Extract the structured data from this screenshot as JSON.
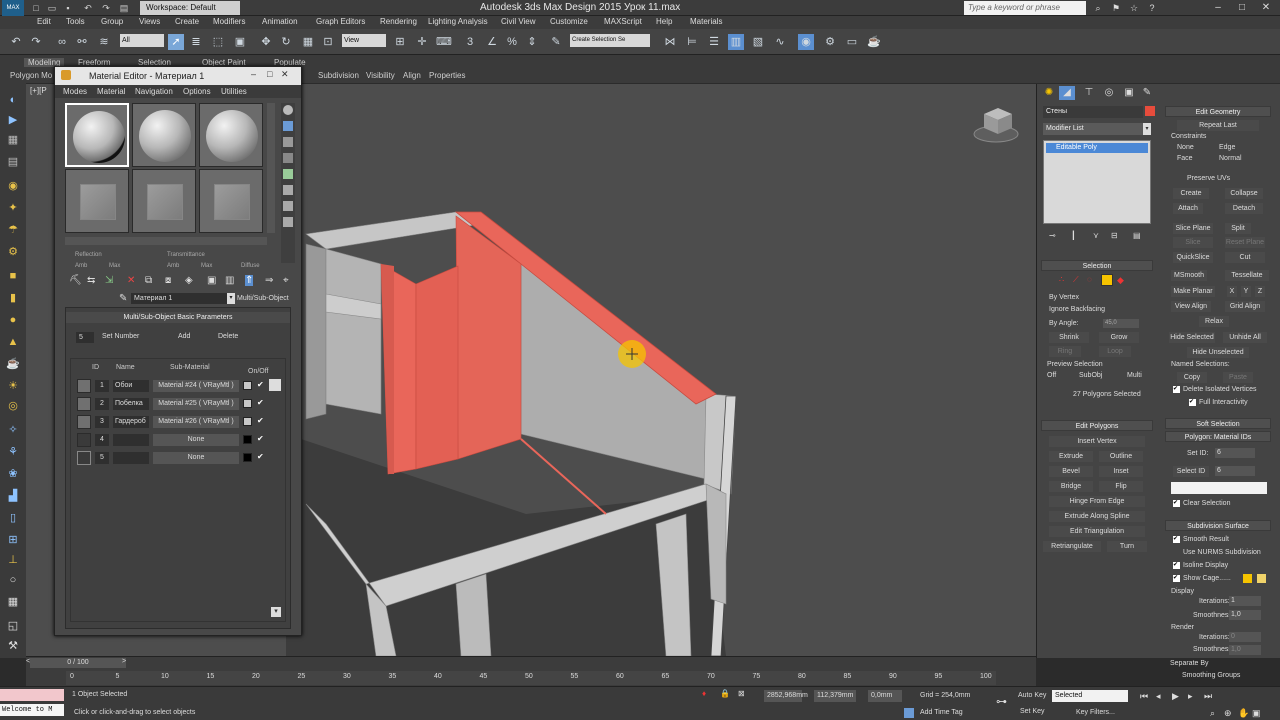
{
  "app": {
    "logo": "MAX",
    "workspace": "Workspace: Default",
    "window_title": "Autodesk 3ds Max Design 2015     Урок 11.max",
    "search_placeholder": "Type a keyword or phrase"
  },
  "menu": [
    "Edit",
    "Tools",
    "Group",
    "Views",
    "Create",
    "Modifiers",
    "Animation",
    "Graph Editors",
    "Rendering",
    "Lighting Analysis",
    "Civil View",
    "Customize",
    "MAXScript",
    "Help",
    "Materials"
  ],
  "toolbar": {
    "filter_value": "All",
    "ref_coord_value": "View",
    "named_sel_value": "Create Selection Se"
  },
  "ribbon": {
    "tabs": [
      "Modeling",
      "Freeform",
      "Selection",
      "Object Paint",
      "Populate"
    ],
    "sub": [
      "Polygon Mo",
      "Subdivision",
      "Visibility",
      "Align",
      "Properties"
    ]
  },
  "viewport": {
    "label": "[+][P"
  },
  "material_editor": {
    "title": "Material Editor - Материал 1",
    "menu": [
      "Modes",
      "Material",
      "Navigation",
      "Options",
      "Utilities"
    ],
    "rows_top": [
      "Reflection",
      "Transmittance",
      "Diffuse",
      "Amb",
      "Max",
      "Amb",
      "Max"
    ],
    "material_name": "Материал 1",
    "material_type": "Multi/Sub-Object",
    "rollout_title": "Multi/Sub-Object Basic Parameters",
    "set_number_value": "5",
    "set_number_label": "Set Number",
    "add_label": "Add",
    "delete_label": "Delete",
    "columns": [
      "ID",
      "Name",
      "Sub-Material",
      "On/Off"
    ],
    "rows": [
      {
        "id": "1",
        "name": "Обои",
        "sub": "Material #24  ( VRayMtl )",
        "color": "#c8c8c8"
      },
      {
        "id": "2",
        "name": "Побелка",
        "sub": "Material #25  ( VRayMtl )",
        "color": "#c8c8c8"
      },
      {
        "id": "3",
        "name": "Гардероб",
        "sub": "Material #26  ( VRayMtl )",
        "color": "#c8c8c8"
      },
      {
        "id": "4",
        "name": "",
        "sub": "None",
        "color": "#000000"
      },
      {
        "id": "5",
        "name": "",
        "sub": "None",
        "color": "#000000"
      }
    ]
  },
  "command_panel": {
    "object_name": "Стены",
    "modifier_list": "Modifier List",
    "stack_item": "Editable Poly",
    "selection": {
      "title": "Selection",
      "by_vertex": "By Vertex",
      "ignore_backfacing": "Ignore Backfacing",
      "by_angle": "By Angle:",
      "by_angle_value": "45,0",
      "shrink": "Shrink",
      "grow": "Grow",
      "ring": "Ring",
      "loop": "Loop",
      "preview": "Preview Selection",
      "preview_opts": [
        "Off",
        "SubObj",
        "Multi"
      ],
      "status": "27 Polygons Selected"
    },
    "edit_polygons": {
      "title": "Edit Polygons",
      "insert_vertex": "Insert Vertex",
      "extrude": "Extrude",
      "outline": "Outline",
      "bevel": "Bevel",
      "inset": "Inset",
      "bridge": "Bridge",
      "flip": "Flip",
      "hinge": "Hinge From Edge",
      "extrude_spline": "Extrude Along Spline",
      "edit_tri": "Edit Triangulation",
      "retriangulate": "Retriangulate",
      "turn": "Turn"
    },
    "edit_geometry": {
      "title": "Edit Geometry",
      "repeat_last": "Repeat Last",
      "constraints": "Constraints",
      "none": "None",
      "edge": "Edge",
      "face": "Face",
      "normal": "Normal",
      "preserve_uvs": "Preserve UVs",
      "create": "Create",
      "collapse": "Collapse",
      "attach": "Attach",
      "detach": "Detach",
      "slice_plane": "Slice Plane",
      "split": "Split",
      "slice": "Slice",
      "reset_plane": "Reset Plane",
      "quickslice": "QuickSlice",
      "cut": "Cut",
      "msmooth": "MSmooth",
      "tessellate": "Tessellate",
      "make_planar": "Make Planar",
      "xyz": [
        "X",
        "Y",
        "Z"
      ],
      "view_align": "View Align",
      "grid_align": "Grid Align",
      "relax": "Relax",
      "hide_selected": "Hide Selected",
      "unhide_all": "Unhide All",
      "hide_unselected": "Hide Unselected",
      "named_selections": "Named Selections:",
      "copy": "Copy",
      "paste": "Paste",
      "delete_isolated": "Delete Isolated Vertices",
      "full_interactivity": "Full Interactivity"
    },
    "soft_selection": "Soft Selection",
    "material_ids": {
      "title": "Polygon: Material IDs",
      "set_id": "Set ID:",
      "set_id_value": "6",
      "select_id": "Select ID",
      "select_id_value": "6",
      "clear_selection": "Clear Selection"
    },
    "subdivision": {
      "title": "Subdivision Surface",
      "smooth_result": "Smooth Result",
      "nurms": "Use NURMS Subdivision",
      "isoline": "Isoline Display",
      "show_cage": "Show Cage......",
      "display": "Display",
      "iterations": "Iterations:",
      "iterations_value": "1",
      "smoothness": "Smoothness:",
      "smoothness_value": "1,0",
      "render": "Render",
      "r_iterations": "Iterations:",
      "r_iterations_value": "0",
      "r_smoothness": "Smoothness:",
      "r_smoothness_value": "1,0",
      "separate_by": "Separate By",
      "smoothing_groups": "Smoothing Groups"
    }
  },
  "timeline": {
    "frame": "0 / 100",
    "ticks": [
      "0",
      "5",
      "10",
      "15",
      "20",
      "25",
      "30",
      "35",
      "40",
      "45",
      "50",
      "55",
      "60",
      "65",
      "70",
      "75",
      "80",
      "85",
      "90",
      "95",
      "100"
    ]
  },
  "status": {
    "welcome": "Welcome to M",
    "objects_selected": "1 Object Selected",
    "hint": "Click or click-and-drag to select objects",
    "x": "2852,968mm",
    "y": "112,379mm",
    "z": "0,0mm",
    "grid": "Grid = 254,0mm",
    "add_time_tag": "Add Time Tag",
    "auto_key": "Auto Key",
    "set_key": "Set Key",
    "selected": "Selected",
    "key_filters": "Key Filters..."
  },
  "colors": {
    "selection": "#e9665a",
    "accent": "#f6c400"
  }
}
